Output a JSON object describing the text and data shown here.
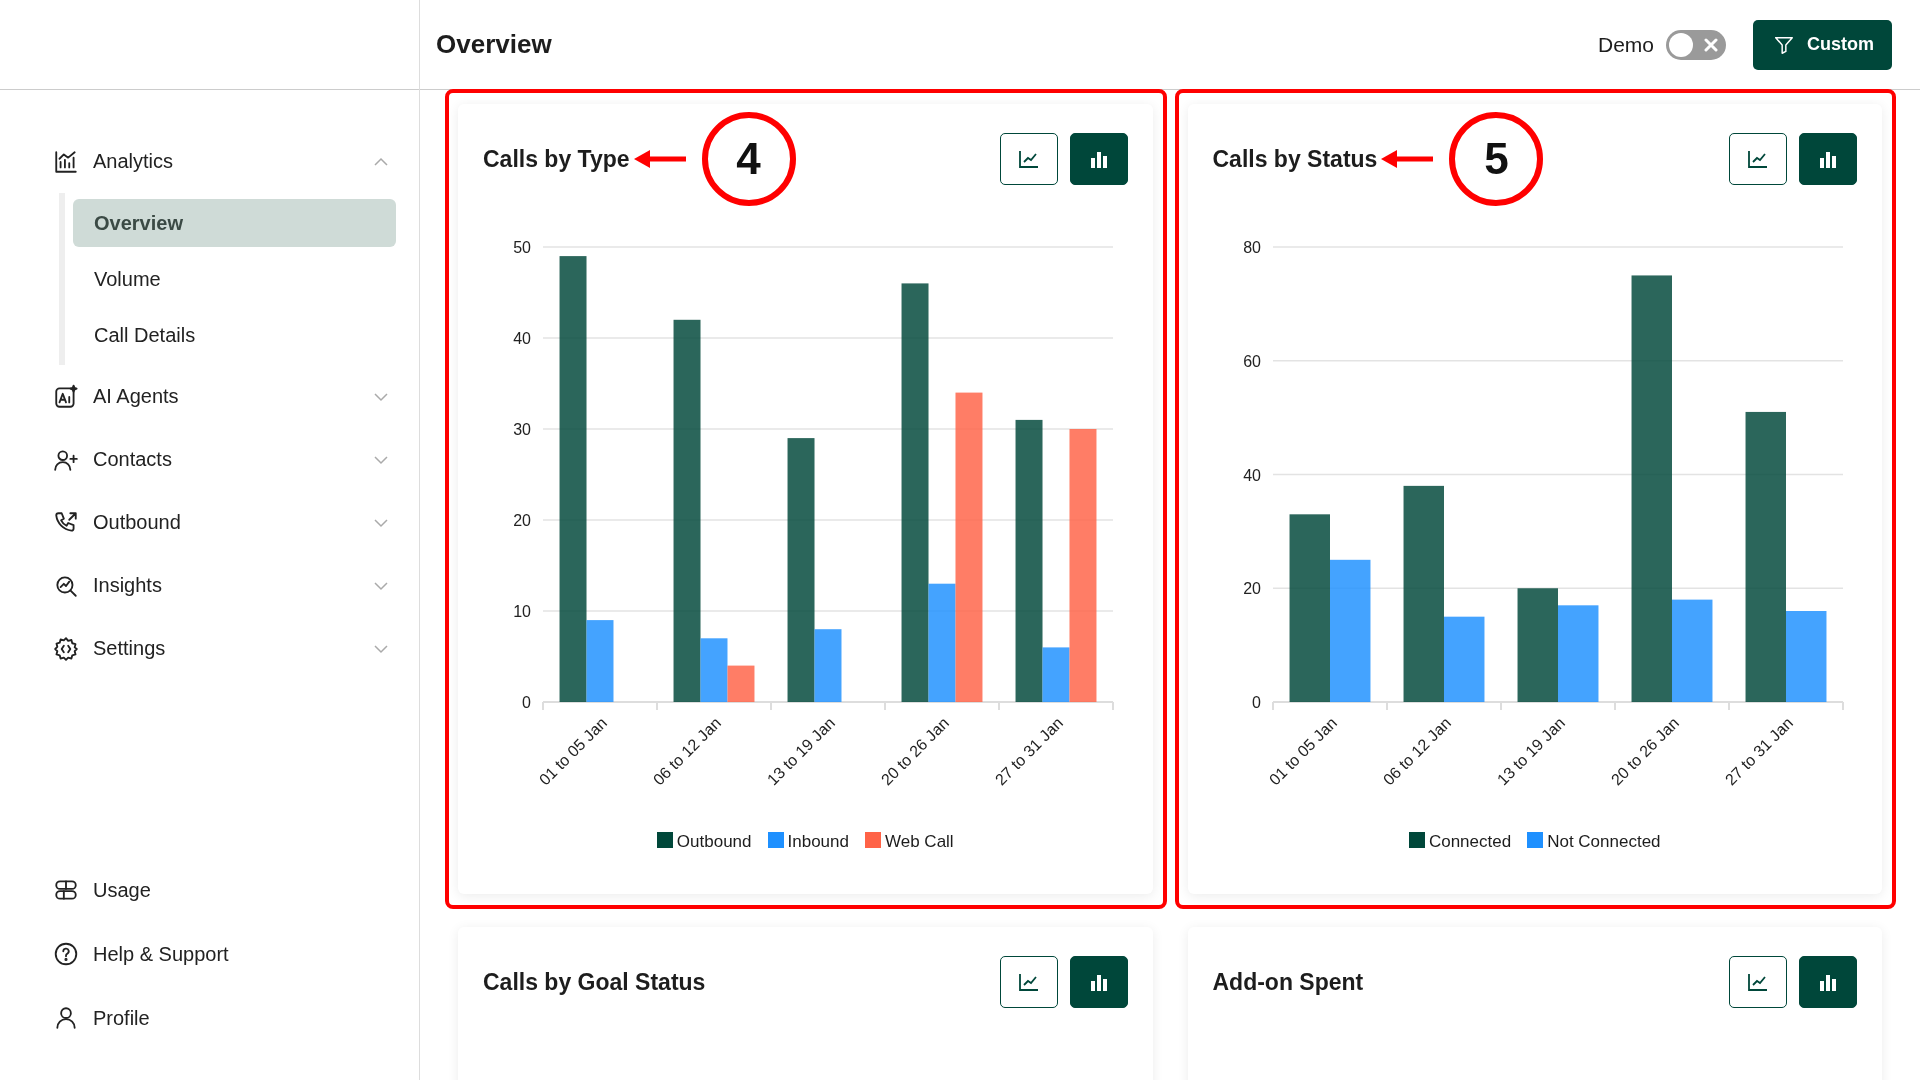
{
  "header": {
    "title": "Overview",
    "demo_toggle": {
      "label": "Demo",
      "on": false
    },
    "filter_button": "Custom"
  },
  "sidebar": {
    "items": [
      {
        "label": "Analytics",
        "expanded": true,
        "children": [
          {
            "label": "Overview",
            "selected": true
          },
          {
            "label": "Volume",
            "selected": false
          },
          {
            "label": "Call Details",
            "selected": false
          }
        ]
      },
      {
        "label": "AI Agents",
        "expanded": false
      },
      {
        "label": "Contacts",
        "expanded": false
      },
      {
        "label": "Outbound",
        "expanded": false
      },
      {
        "label": "Insights",
        "expanded": false
      },
      {
        "label": "Settings",
        "expanded": false
      }
    ],
    "footer_items": [
      {
        "label": "Usage"
      },
      {
        "label": "Help & Support"
      },
      {
        "label": "Profile"
      }
    ]
  },
  "cards": [
    {
      "title": "Calls by Type",
      "callout": "4",
      "views": [
        {
          "kind": "line",
          "selected": false
        },
        {
          "kind": "bar",
          "selected": true
        }
      ],
      "chart_data": {
        "type": "bar",
        "categories": [
          "01 to 05 Jan",
          "06 to 12 Jan",
          "13 to 19 Jan",
          "20 to 26 Jan",
          "27 to 31 Jan"
        ],
        "ylim": [
          0,
          50
        ],
        "grid": true,
        "yticks": [
          0,
          10,
          20,
          30,
          40,
          50
        ],
        "series": [
          {
            "name": "Outbound",
            "color": "#00473a",
            "values": [
              49,
              42,
              29,
              46,
              31
            ]
          },
          {
            "name": "Inbound",
            "color": "#1e90ff",
            "values": [
              9,
              7,
              8,
              13,
              6
            ]
          },
          {
            "name": "Web Call",
            "color": "#ff6347",
            "values": [
              0,
              4,
              0,
              34,
              30
            ]
          }
        ]
      }
    },
    {
      "title": "Calls by Status",
      "callout": "5",
      "views": [
        {
          "kind": "line",
          "selected": false
        },
        {
          "kind": "bar",
          "selected": true
        }
      ],
      "chart_data": {
        "type": "bar",
        "categories": [
          "01 to 05 Jan",
          "06 to 12 Jan",
          "13 to 19 Jan",
          "20 to 26 Jan",
          "27 to 31 Jan"
        ],
        "ylim": [
          0,
          80
        ],
        "grid": true,
        "yticks": [
          0,
          20,
          40,
          60,
          80
        ],
        "series": [
          {
            "name": "Connected",
            "color": "#00473a",
            "values": [
              33,
              38,
              20,
              75,
              51
            ]
          },
          {
            "name": "Not Connected",
            "color": "#1e90ff",
            "values": [
              25,
              15,
              17,
              18,
              16
            ]
          }
        ]
      }
    },
    {
      "title": "Calls by Goal Status",
      "views": [
        {
          "kind": "line",
          "selected": false
        },
        {
          "kind": "bar",
          "selected": true
        }
      ]
    },
    {
      "title": "Add-on Spent",
      "views": [
        {
          "kind": "line",
          "selected": false
        },
        {
          "kind": "bar",
          "selected": true
        }
      ]
    }
  ]
}
